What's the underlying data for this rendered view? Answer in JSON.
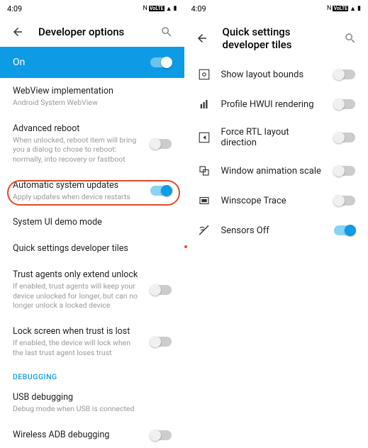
{
  "statusbar": {
    "time": "4:09",
    "nfc": "N",
    "volte": "VoLTE",
    "signal": "▲",
    "battery": "▮"
  },
  "left": {
    "title": "Developer options",
    "on_label": "On",
    "items": [
      {
        "title": "WebView implementation",
        "sub": "Android System WebView"
      },
      {
        "title": "Advanced reboot",
        "sub": "When unlocked, reboot item will bring you a dialog to chose to reboot: normally, into recovery or fastboot",
        "toggle": "off"
      },
      {
        "title": "Automatic system updates",
        "sub": "Apply updates when device restarts",
        "toggle": "on"
      },
      {
        "title": "System UI demo mode"
      },
      {
        "title": "Quick settings developer tiles"
      },
      {
        "title": "Trust agents only extend unlock",
        "sub": "If enabled, trust agents will keep your device unlocked for longer, but can no longer unlock a locked device",
        "toggle": "off"
      },
      {
        "title": "Lock screen when trust is lost",
        "sub": "If enabled, the device will lock when the last trust agent loses trust",
        "toggle": "off"
      }
    ],
    "section": "DEBUGGING",
    "debug_items": [
      {
        "title": "USB debugging",
        "sub": "Debug mode when USB is connected"
      },
      {
        "title": "Wireless ADB debugging",
        "toggle": "off"
      }
    ]
  },
  "right": {
    "title": "Quick settings developer tiles",
    "items": [
      {
        "icon": "layout",
        "title": "Show layout bounds",
        "toggle": "off"
      },
      {
        "icon": "profile",
        "title": "Profile HWUI rendering",
        "toggle": "off"
      },
      {
        "icon": "rtl",
        "title": "Force RTL layout direction",
        "toggle": "off"
      },
      {
        "icon": "anim",
        "title": "Window animation scale",
        "toggle": "off"
      },
      {
        "icon": "winscope",
        "title": "Winscope Trace",
        "toggle": "off"
      },
      {
        "icon": "sensors",
        "title": "Sensors Off",
        "toggle": "on"
      }
    ]
  }
}
